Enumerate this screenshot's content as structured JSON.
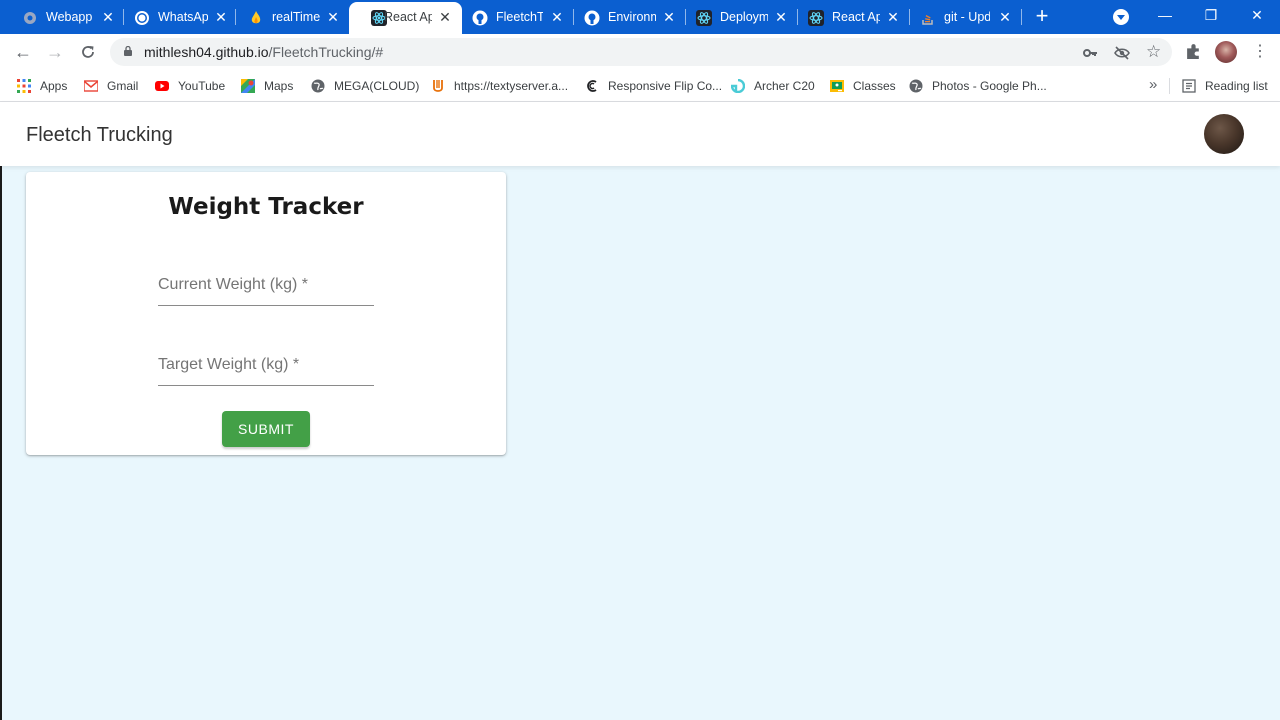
{
  "browser": {
    "tabs": [
      {
        "title": "Webapp",
        "icon": "gear-favicon"
      },
      {
        "title": "WhatsApp",
        "icon": "whatsapp-favicon"
      },
      {
        "title": "realTime",
        "icon": "flame-favicon"
      },
      {
        "title": "React App",
        "icon": "react-favicon",
        "active": true
      },
      {
        "title": "FleetchTrucking",
        "icon": "github-favicon"
      },
      {
        "title": "Environment",
        "icon": "github-favicon"
      },
      {
        "title": "Deployment",
        "icon": "react-favicon"
      },
      {
        "title": "React App",
        "icon": "react-favicon"
      },
      {
        "title": "git - Update",
        "icon": "stackoverflow-favicon"
      }
    ],
    "url_host": "mithlesh04.github.io",
    "url_path": "/FleetchTrucking/#",
    "bookmarks": [
      {
        "label": "Apps",
        "icon": "apps-grid-icon"
      },
      {
        "label": "Gmail",
        "icon": "gmail-icon"
      },
      {
        "label": "YouTube",
        "icon": "youtube-icon"
      },
      {
        "label": "Maps",
        "icon": "maps-icon"
      },
      {
        "label": "MEGA(CLOUD)",
        "icon": "globe-icon"
      },
      {
        "label": "https://textyserver.a...",
        "icon": "texty-icon"
      },
      {
        "label": "Responsive Flip Co...",
        "icon": "codepen-icon"
      },
      {
        "label": "Archer C20",
        "icon": "tplink-icon"
      },
      {
        "label": "Classes",
        "icon": "classroom-icon"
      },
      {
        "label": "Photos - Google Ph...",
        "icon": "globe-icon"
      }
    ],
    "reading_list": "Reading list",
    "more_bookmarks": "»"
  },
  "app": {
    "brand": "Fleetch Trucking",
    "card": {
      "title": "Weight Tracker",
      "current_weight_label": "Current Weight (kg) *",
      "target_weight_label": "Target Weight (kg) *",
      "submit_label": "SUBMIT"
    }
  },
  "colors": {
    "tab_strip": "#0b5fd0",
    "page_background": "#e9f7fd",
    "submit_button": "#43a047"
  }
}
